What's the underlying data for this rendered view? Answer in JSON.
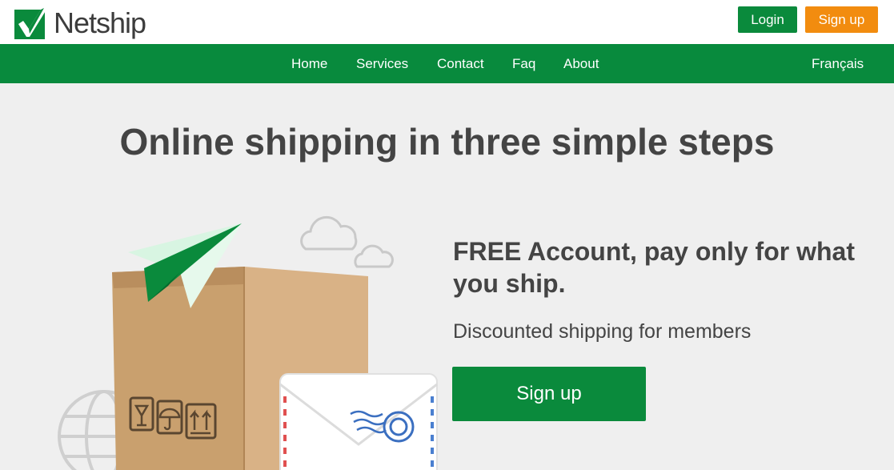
{
  "header": {
    "logo_text": "Netship",
    "login_label": "Login",
    "signup_label": "Sign up"
  },
  "nav": {
    "items": [
      "Home",
      "Services",
      "Contact",
      "Faq",
      "About"
    ],
    "language": "Français"
  },
  "hero": {
    "title": "Online shipping in three simple steps",
    "free_title": "FREE Account, pay only for what you ship.",
    "subtitle": "Discounted shipping for members",
    "signup_label": "Sign up"
  },
  "colors": {
    "brand_green": "#088a3d",
    "signup_orange": "#f28c0f",
    "background": "#efefef",
    "text_dark": "#444444"
  },
  "icons": [
    "checkmark-logo-icon",
    "paper-plane-icon",
    "package-box-icon",
    "envelope-icon",
    "cloud-icon",
    "globe-icon"
  ]
}
